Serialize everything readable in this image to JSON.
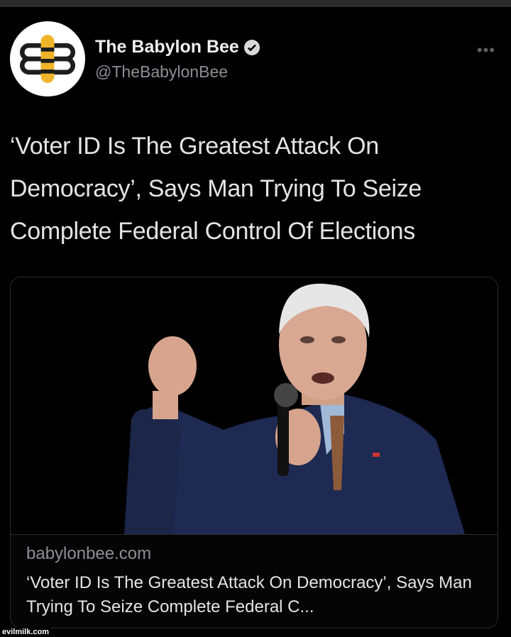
{
  "tweet": {
    "author_name": "The Babylon Bee",
    "handle": "@TheBabylonBee",
    "text": "‘Voter ID Is The Greatest Attack On Democracy’, Says Man Trying To Seize Complete Federal Control Of Elections",
    "more_icon": "more-dots-icon",
    "verified_icon": "verified-badge-icon",
    "accent_color": "#f0b429"
  },
  "card": {
    "domain": "babylonbee.com",
    "title": "‘Voter ID Is The Greatest Attack On Democracy’, Says Man Trying To Seize Complete Federal C..."
  },
  "watermark": "evilmilk.com"
}
